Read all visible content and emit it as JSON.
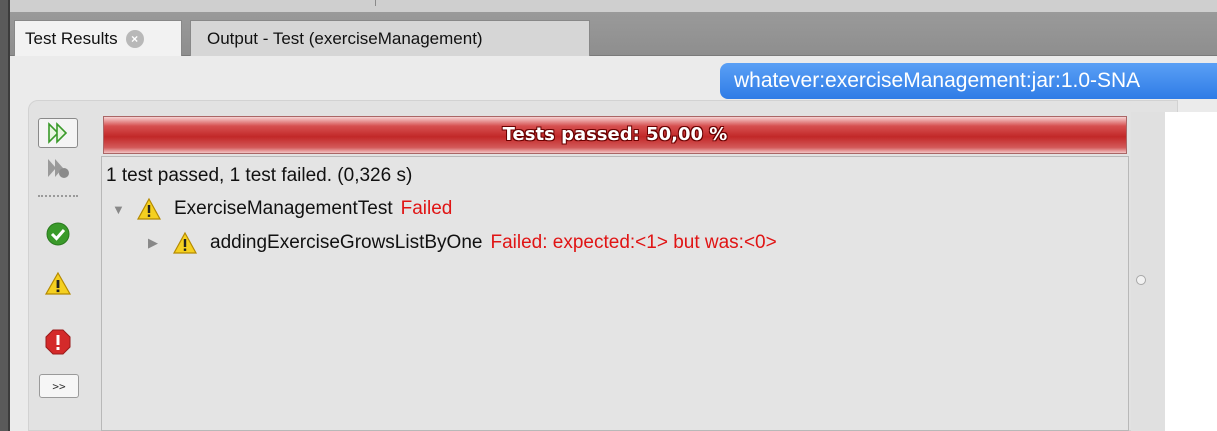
{
  "tabs": [
    {
      "label": "Test Results",
      "active": true,
      "close_glyph": "×"
    },
    {
      "label": "Output - Test (exerciseManagement)",
      "active": false
    }
  ],
  "project_badge": "whatever:exerciseManagement:jar:1.0-SNA",
  "toolbar": {
    "more_label": ">>",
    "icons": [
      "rerun-icon",
      "rerun-failed-icon",
      "show-passed-icon",
      "show-failures-icon",
      "show-errors-icon"
    ]
  },
  "progress": {
    "label": "Tests passed: 50,00 %",
    "percent_passed": 50,
    "color": "#c22828"
  },
  "results": {
    "summary": "1 test passed, 1 test failed. (0,326 s)",
    "tree": [
      {
        "name": "ExerciseManagementTest",
        "status": "Failed",
        "expanded": true,
        "icon": "warning-icon"
      },
      {
        "name": "addingExerciseGrowsListByOne",
        "status": "Failed: expected:<1> but was:<0>",
        "expanded": false,
        "icon": "warning-icon"
      }
    ]
  },
  "colors": {
    "failed_text": "#e01414",
    "badge_blue": "#2f7ce6",
    "passed_green": "#3a9a2a",
    "warning_yellow": "#f5d020",
    "error_red": "#d42a2a"
  }
}
